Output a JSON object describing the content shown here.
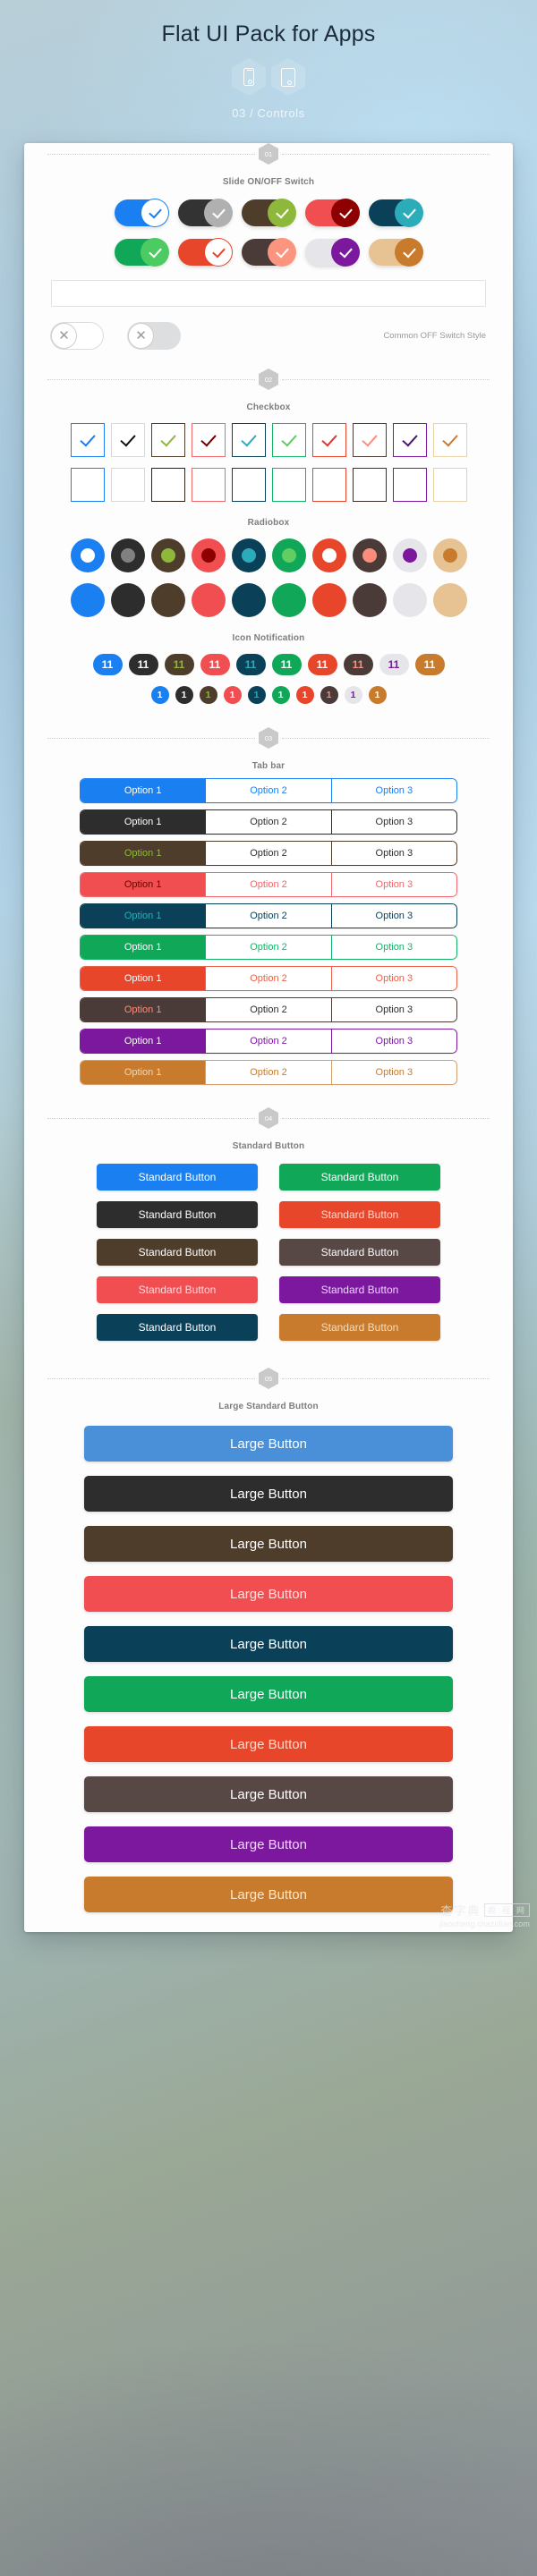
{
  "header": {
    "title": "Flat UI Pack for Apps",
    "subtitle": "03 / Controls",
    "device_icons": [
      "phone-icon",
      "tablet-icon"
    ]
  },
  "sections": [
    {
      "number": "01",
      "label": "Slide ON/OFF Switch"
    },
    {
      "number": "02",
      "label": "Checkbox"
    },
    {
      "number": "03",
      "label": "Tab bar"
    },
    {
      "number": "04",
      "label": "Standard Button"
    },
    {
      "number": "05",
      "label": "Large Standard Button"
    }
  ],
  "sub_labels": {
    "radiobox": "Radiobox",
    "icon_notification": "Icon Notification"
  },
  "switches": {
    "row1": [
      {
        "track": "#1a7ff0",
        "knob": "#ffffff",
        "check": "#1a7ff0",
        "knob_border": "#1a7ff0"
      },
      {
        "track": "#333333",
        "knob": "#b0b0b0",
        "check": "#ffffff",
        "knob_border": "#b0b0b0"
      },
      {
        "track": "#4f3d2c",
        "knob": "#8eb83c",
        "check": "#ffffff",
        "knob_border": "#8eb83c"
      },
      {
        "track": "#f04e51",
        "knob": "#8e0000",
        "check": "#ffffff",
        "knob_border": "#8e0000"
      },
      {
        "track": "#0a4158",
        "knob": "#2cacb9",
        "check": "#ffffff",
        "knob_border": "#2cacb9"
      }
    ],
    "row2": [
      {
        "track": "#10a759",
        "knob": "#4dcb63",
        "check": "#ffffff",
        "knob_border": "#4dcb63"
      },
      {
        "track": "#e8462a",
        "knob": "#ffffff",
        "check": "#e8462a",
        "knob_border": "#e8462a"
      },
      {
        "track": "#4a3b38",
        "knob": "#fc957f",
        "check": "#ffffff",
        "knob_border": "#fc957f"
      },
      {
        "track": "#e6e6ea",
        "knob": "#7b189e",
        "check": "#ffffff",
        "knob_border": "#7b189e"
      },
      {
        "track": "#e7c293",
        "knob": "#c87b2c",
        "check": "#ffffff",
        "knob_border": "#c87b2c"
      }
    ],
    "off": {
      "label": "Common OFF Switch Style",
      "items": [
        {
          "track": "#ffffff",
          "track_border": "#dcdcdc"
        },
        {
          "track": "#dddee0",
          "track_border": "#dddee0"
        }
      ],
      "icon": "close-icon",
      "icon_glyph": "✕"
    }
  },
  "checkbox": {
    "row1": [
      {
        "border": "#1a7ff0",
        "check": "#1a7ff0"
      },
      {
        "border": "#d8d8d8",
        "check": "#111111"
      },
      {
        "border": "#4f3d2c",
        "check": "#8eb83c"
      },
      {
        "border": "#f0686b",
        "check": "#6e0000"
      },
      {
        "border": "#0a4158",
        "check": "#2cacb9"
      },
      {
        "border": "#15b26a",
        "check": "#60c95f"
      },
      {
        "border": "#e8462a",
        "check": "#d8392c"
      },
      {
        "border": "#4a3b38",
        "check": "#fc8d7b"
      },
      {
        "border": "#7b189e",
        "check": "#4a1670"
      },
      {
        "border": "#e7d1a6",
        "check": "#c87b2c"
      }
    ],
    "row2": [
      {
        "border": "#1a7ff0",
        "check": null
      },
      {
        "border": "#d8d8d8",
        "check": null
      },
      {
        "border": "#2a2118",
        "check": null
      },
      {
        "border": "#f0686b",
        "check": null
      },
      {
        "border": "#0a4158",
        "check": null
      },
      {
        "border": "#15b26a",
        "check": null
      },
      {
        "border": "#e8462a",
        "check": null
      },
      {
        "border": "#3d2f2c",
        "check": null
      },
      {
        "border": "#7b189e",
        "check": null
      },
      {
        "border": "#e7d1a6",
        "check": null
      }
    ]
  },
  "radiobox": {
    "row1": [
      {
        "outer": "#1a7ff0",
        "inner": "#ffffff"
      },
      {
        "outer": "#2d2d2d",
        "inner": "#818181"
      },
      {
        "outer": "#4f3d2c",
        "inner": "#8eb83c"
      },
      {
        "outer": "#f04e51",
        "inner": "#8e0000"
      },
      {
        "outer": "#0a4158",
        "inner": "#2cacb9"
      },
      {
        "outer": "#10a759",
        "inner": "#62cd62"
      },
      {
        "outer": "#e8462a",
        "inner": "#ffffff"
      },
      {
        "outer": "#4a3b38",
        "inner": "#fc8d7b"
      },
      {
        "outer": "#e6e6ea",
        "inner": "#7b189e"
      },
      {
        "outer": "#e7c293",
        "inner": "#c87b2c"
      }
    ],
    "row2": [
      {
        "outer": "#1a7ff0",
        "inner": null
      },
      {
        "outer": "#2d2d2d",
        "inner": null
      },
      {
        "outer": "#4f3d2c",
        "inner": null
      },
      {
        "outer": "#f04e51",
        "inner": null
      },
      {
        "outer": "#0a4158",
        "inner": null
      },
      {
        "outer": "#10a759",
        "inner": null
      },
      {
        "outer": "#e8462a",
        "inner": null
      },
      {
        "outer": "#4a3b38",
        "inner": null
      },
      {
        "outer": "#e6e6ea",
        "inner": null
      },
      {
        "outer": "#e7c293",
        "inner": null
      }
    ]
  },
  "notifications": {
    "row1_value": "11",
    "row2_value": "1",
    "row1": [
      {
        "bg": "#1a7ff0",
        "fg": "#ffffff"
      },
      {
        "bg": "#2d2d2d",
        "fg": "#ffffff"
      },
      {
        "bg": "#4f3d2c",
        "fg": "#8eb83c"
      },
      {
        "bg": "#f04e51",
        "fg": "#ffffff"
      },
      {
        "bg": "#0a4158",
        "fg": "#2cacb9"
      },
      {
        "bg": "#10a759",
        "fg": "#ffffff"
      },
      {
        "bg": "#e8462a",
        "fg": "#ffffff"
      },
      {
        "bg": "#4a3b38",
        "fg": "#fc8d7b"
      },
      {
        "bg": "#e6e6ea",
        "fg": "#7b189e"
      },
      {
        "bg": "#c87b2c",
        "fg": "#ffffff"
      }
    ],
    "row2": [
      {
        "bg": "#1a7ff0",
        "fg": "#ffffff"
      },
      {
        "bg": "#2d2d2d",
        "fg": "#ffffff"
      },
      {
        "bg": "#4f3d2c",
        "fg": "#8eb83c"
      },
      {
        "bg": "#f04e51",
        "fg": "#ffffff"
      },
      {
        "bg": "#0a4158",
        "fg": "#2cacb9"
      },
      {
        "bg": "#10a759",
        "fg": "#ffffff"
      },
      {
        "bg": "#e8462a",
        "fg": "#ffffff"
      },
      {
        "bg": "#4a3b38",
        "fg": "#fc8d7b"
      },
      {
        "bg": "#e6e6ea",
        "fg": "#7b189e"
      },
      {
        "bg": "#c87b2c",
        "fg": "#ffffff"
      }
    ]
  },
  "tabbar": {
    "options": [
      "Option 1",
      "Option 2",
      "Option 3"
    ],
    "rows": [
      {
        "fill": "#1a7ff0",
        "border": "#1a7ff0",
        "active_fg": "#ffffff",
        "inactive_fg": "#1a7ff0"
      },
      {
        "fill": "#2d2d2d",
        "border": "#2d2d2d",
        "active_fg": "#ffffff",
        "inactive_fg": "#2d2d2d"
      },
      {
        "fill": "#4f3d2c",
        "border": "#4f3d2c",
        "active_fg": "#8eb83c",
        "inactive_fg": "#2d2d2d"
      },
      {
        "fill": "#f04e51",
        "border": "#f0686b",
        "active_fg": "#6e0000",
        "inactive_fg": "#f0686b"
      },
      {
        "fill": "#0a4158",
        "border": "#0a4158",
        "active_fg": "#2cacb9",
        "inactive_fg": "#0a4158"
      },
      {
        "fill": "#10a759",
        "border": "#15b26a",
        "active_fg": "#ffffff",
        "inactive_fg": "#15b26a"
      },
      {
        "fill": "#e8462a",
        "border": "#e8624a",
        "active_fg": "#ffffff",
        "inactive_fg": "#e8624a"
      },
      {
        "fill": "#4a3b38",
        "border": "#4a3b38",
        "active_fg": "#fc8d7b",
        "inactive_fg": "#2d2d2d"
      },
      {
        "fill": "#7b189e",
        "border": "#7b189e",
        "active_fg": "#ffffff",
        "inactive_fg": "#7b189e"
      },
      {
        "fill": "#c87b2c",
        "border": "#d0a070",
        "active_fg": "#f2d7ae",
        "inactive_fg": "#c87b2c"
      }
    ]
  },
  "standard_buttons": {
    "label": "Standard Button",
    "items": [
      {
        "bg": "#1a7ff0",
        "fg": "#ffffff"
      },
      {
        "bg": "#10a759",
        "fg": "#ffffff"
      },
      {
        "bg": "#2d2d2d",
        "fg": "#ffffff"
      },
      {
        "bg": "#e8462a",
        "fg": "#ffd7cd"
      },
      {
        "bg": "#4f3d2c",
        "fg": "#ffffff"
      },
      {
        "bg": "#574745",
        "fg": "#ffffff"
      },
      {
        "bg": "#f04e51",
        "fg": "#ffd9de"
      },
      {
        "bg": "#7b189e",
        "fg": "#f0d2ff"
      },
      {
        "bg": "#0a4158",
        "fg": "#ffffff"
      },
      {
        "bg": "#c87b2c",
        "fg": "#f7dcbb"
      }
    ]
  },
  "large_buttons": {
    "label": "Large Button",
    "items": [
      {
        "bg": "#4a90d9",
        "fg": "#ffffff"
      },
      {
        "bg": "#2d2d2d",
        "fg": "#ffffff"
      },
      {
        "bg": "#4f3d2c",
        "fg": "#ffffff"
      },
      {
        "bg": "#f04e51",
        "fg": "#ffe3e3"
      },
      {
        "bg": "#0a4158",
        "fg": "#ffffff"
      },
      {
        "bg": "#10a759",
        "fg": "#ffffff"
      },
      {
        "bg": "#e8462a",
        "fg": "#ffdccf"
      },
      {
        "bg": "#574745",
        "fg": "#ffffff"
      },
      {
        "bg": "#7b189e",
        "fg": "#f3d6ff"
      },
      {
        "bg": "#c87b2c",
        "fg": "#ffe7c9"
      }
    ]
  },
  "watermark": {
    "cn_main": "查字典",
    "cn_box": "教 程 网",
    "url": "jiaocheng.chazidian.com"
  }
}
